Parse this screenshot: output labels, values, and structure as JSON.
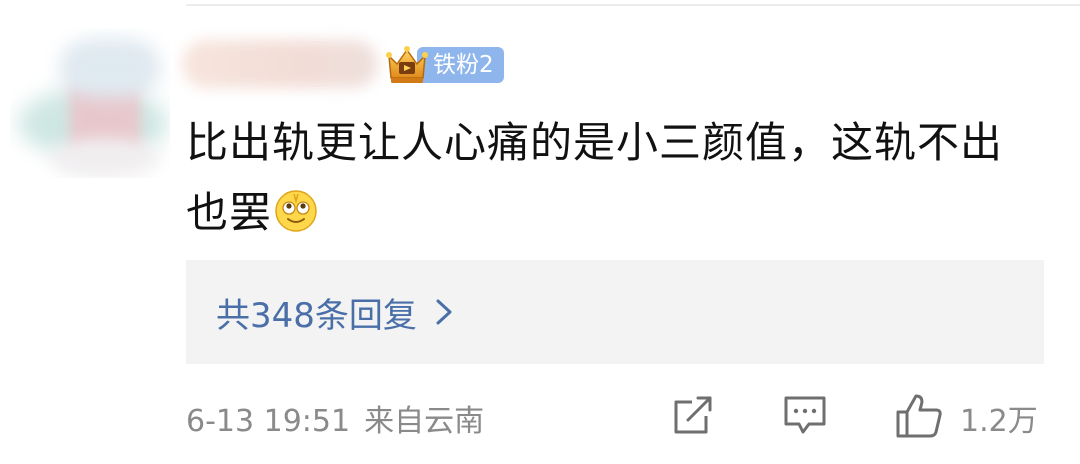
{
  "fan_badge": {
    "label": "铁粉",
    "level": "2"
  },
  "comment": {
    "line1": "比出轨更让人心痛的是小三颜值，这轨不出",
    "line2": "也罢"
  },
  "replies": {
    "label": "共348条回复"
  },
  "footer": {
    "datetime": "6-13 19:51",
    "location": "来自云南",
    "like_count": "1.2万"
  },
  "icons": {
    "share": "share-edit-icon",
    "comment": "comment-icon",
    "like": "thumbs-up-icon",
    "emoji": "smiling-face-emoji-icon",
    "badge": "crown-icon"
  },
  "colors": {
    "reply_link": "#4a6fa8",
    "badge_bg": "#8fb6ec",
    "meta_gray": "#8a8a8a"
  }
}
